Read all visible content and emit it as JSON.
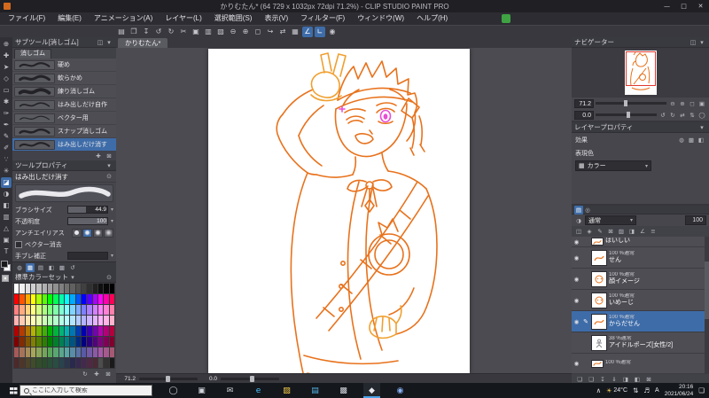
{
  "ui_colors": {
    "selection": "#3e6ca8",
    "line_orange": "#e8721c",
    "eye_pink": "#e84fd4",
    "active_app_underline": "#4aa3e8"
  },
  "titlebar": {
    "title": "かりむたん* (64 729 x 1032px 72dpi 71.2%) - CLIP STUDIO PAINT PRO",
    "minimize": "—",
    "maximize": "□",
    "close": "✕"
  },
  "menubar": {
    "items": [
      {
        "name": "menu-file",
        "label": "ファイル(F)"
      },
      {
        "name": "menu-edit",
        "label": "編集(E)"
      },
      {
        "name": "menu-animation",
        "label": "アニメーション(A)"
      },
      {
        "name": "menu-layer",
        "label": "レイヤー(L)"
      },
      {
        "name": "menu-selection",
        "label": "選択範囲(S)"
      },
      {
        "name": "menu-view",
        "label": "表示(V)"
      },
      {
        "name": "menu-filter",
        "label": "フィルター(F)"
      },
      {
        "name": "menu-window",
        "label": "ウィンドウ(W)"
      },
      {
        "name": "menu-help",
        "label": "ヘルプ(H)"
      }
    ]
  },
  "commandbar": {
    "icons": [
      {
        "name": "new-file-icon",
        "glyph": "▤"
      },
      {
        "name": "open-file-icon",
        "glyph": "❒"
      },
      {
        "name": "save-icon",
        "glyph": "↧"
      },
      {
        "name": "undo-icon",
        "glyph": "↺"
      },
      {
        "name": "redo-icon",
        "glyph": "↻"
      },
      {
        "name": "cut-icon",
        "glyph": "✂"
      },
      {
        "name": "copy-icon",
        "glyph": "▣"
      },
      {
        "name": "paste-icon",
        "glyph": "▥"
      },
      {
        "name": "erase-icon",
        "glyph": "▨"
      },
      {
        "name": "zoom-out-icon",
        "glyph": "⊖"
      },
      {
        "name": "zoom-in-icon",
        "glyph": "⊕"
      },
      {
        "name": "fit-screen-icon",
        "glyph": "◻"
      },
      {
        "name": "rotate-view-icon",
        "glyph": "↪"
      },
      {
        "name": "flip-view-icon",
        "glyph": "⇄"
      },
      {
        "name": "grid-icon",
        "glyph": "▦"
      },
      {
        "name": "snap-ruler-icon",
        "glyph": "∠",
        "active": true
      },
      {
        "name": "snap-special-ruler-icon",
        "glyph": "∟",
        "active": true
      },
      {
        "name": "workspace-settings-icon",
        "glyph": "◉"
      }
    ]
  },
  "toolstrip": {
    "tools": [
      {
        "name": "tool-zoom",
        "glyph": "⊕"
      },
      {
        "name": "tool-move",
        "glyph": "✚"
      },
      {
        "name": "tool-object",
        "glyph": "➤"
      },
      {
        "name": "tool-layer-move",
        "glyph": "◇"
      },
      {
        "name": "tool-selection",
        "glyph": "▭"
      },
      {
        "name": "tool-auto-select",
        "glyph": "✱"
      },
      {
        "name": "tool-eyedropper",
        "glyph": "✑"
      },
      {
        "name": "tool-pen",
        "glyph": "✒"
      },
      {
        "name": "tool-pencil",
        "glyph": "✎"
      },
      {
        "name": "tool-brush",
        "glyph": "✐"
      },
      {
        "name": "tool-airbrush",
        "glyph": "∵"
      },
      {
        "name": "tool-decoration",
        "glyph": "✳"
      },
      {
        "name": "tool-eraser",
        "glyph": "◪",
        "selected": true
      },
      {
        "name": "tool-blend",
        "glyph": "◑"
      },
      {
        "name": "tool-fill",
        "glyph": "◧"
      },
      {
        "name": "tool-gradient",
        "glyph": "▥"
      },
      {
        "name": "tool-figure",
        "glyph": "△"
      },
      {
        "name": "tool-frame",
        "glyph": "▣"
      },
      {
        "name": "tool-text",
        "glyph": "T"
      }
    ],
    "main_color": "#000000",
    "sub_color": "#ffffff"
  },
  "subtool": {
    "title": "サブツール[消しゴム]",
    "group_tab": "消しゴム",
    "items": [
      {
        "label": "硬め"
      },
      {
        "label": "軟らかめ"
      },
      {
        "label": "練り消しゴム"
      },
      {
        "label": "はみ出しだけ自作"
      },
      {
        "label": "ベクター用"
      },
      {
        "label": "スナップ消しゴム"
      },
      {
        "label": "はみ出しだけ消す",
        "selected": true
      }
    ],
    "footer_icons": [
      {
        "name": "add-subtool-icon",
        "glyph": "✚"
      },
      {
        "name": "delete-subtool-icon",
        "glyph": "⊠"
      }
    ]
  },
  "toolprop": {
    "title": "ツールプロパティ",
    "subtitle": "はみ出しだけ消す",
    "settings": [
      {
        "label": "ブラシサイズ",
        "value": "44.9"
      },
      {
        "label": "不透明度",
        "value": "100"
      },
      {
        "label": "アンチエイリアス",
        "value": ""
      },
      {
        "label": "ベクター消去",
        "value": ""
      },
      {
        "label": "手ブレ補正",
        "value": ""
      }
    ]
  },
  "colorset": {
    "title": "標準カラーセット",
    "tab_icons": [
      {
        "name": "color-wheel-icon",
        "glyph": "◍"
      },
      {
        "name": "color-set-icon",
        "glyph": "▦",
        "selected": true
      },
      {
        "name": "color-slider-icon",
        "glyph": "▤"
      },
      {
        "name": "color-mixer-icon",
        "glyph": "◧"
      },
      {
        "name": "approx-color-icon",
        "glyph": "▩"
      },
      {
        "name": "color-history-icon",
        "glyph": "↺"
      }
    ],
    "footer_icons": [
      {
        "name": "replace-color-icon",
        "glyph": "↻"
      },
      {
        "name": "add-color-icon",
        "glyph": "✚"
      },
      {
        "name": "delete-color-icon",
        "glyph": "⊠"
      }
    ],
    "rows": [
      [
        "#ffffff",
        "#f0f0f0",
        "#e0e0e0",
        "#d0d0d0",
        "#c0c0c0",
        "#b0b0b0",
        "#a0a0a0",
        "#909090",
        "#808080",
        "#707070",
        "#606060",
        "#505050",
        "#404040",
        "#303030",
        "#202020",
        "#101010",
        "#080808",
        "#000000"
      ],
      [
        "#ff0000",
        "#ff5500",
        "#ffaa00",
        "#ffff00",
        "#aaff00",
        "#55ff00",
        "#00ff00",
        "#00ff55",
        "#00ffaa",
        "#00ffff",
        "#00aaff",
        "#0055ff",
        "#0000ff",
        "#5500ff",
        "#aa00ff",
        "#ff00ff",
        "#ff00aa",
        "#ff0055"
      ],
      [
        "#ff8080",
        "#ffaa80",
        "#ffd480",
        "#ffff80",
        "#d4ff80",
        "#aaff80",
        "#80ff80",
        "#80ffaa",
        "#80ffd4",
        "#80ffff",
        "#80d4ff",
        "#80aaff",
        "#8080ff",
        "#aa80ff",
        "#d480ff",
        "#ff80ff",
        "#ff80d4",
        "#ff80aa"
      ],
      [
        "#ffb3b3",
        "#ffccb3",
        "#ffe6b3",
        "#ffffb3",
        "#e6ffb3",
        "#ccffb3",
        "#b3ffb3",
        "#b3ffcc",
        "#b3ffe6",
        "#b3ffff",
        "#b3e6ff",
        "#b3ccff",
        "#b3b3ff",
        "#ccb3ff",
        "#e6b3ff",
        "#ffb3ff",
        "#ffb3e6",
        "#ffb3cc"
      ],
      [
        "#b30000",
        "#b33c00",
        "#b37700",
        "#b3b300",
        "#77b300",
        "#3cb300",
        "#00b300",
        "#00b33c",
        "#00b377",
        "#00b3b3",
        "#0077b3",
        "#003cb3",
        "#0000b3",
        "#3c00b3",
        "#7700b3",
        "#b300b3",
        "#b30077",
        "#b3003c"
      ],
      [
        "#800000",
        "#802b00",
        "#805500",
        "#808000",
        "#558000",
        "#2b8000",
        "#008000",
        "#00802b",
        "#008055",
        "#008080",
        "#005580",
        "#002b80",
        "#000080",
        "#2b0080",
        "#550080",
        "#800080",
        "#800055",
        "#80002b"
      ],
      [
        "#a65959",
        "#a67359",
        "#a68c59",
        "#a6a659",
        "#8ca659",
        "#73a659",
        "#59a659",
        "#59a673",
        "#59a68c",
        "#59a6a6",
        "#598ca6",
        "#5973a6",
        "#5959a6",
        "#7359a6",
        "#8c59a6",
        "#a659a6",
        "#a6598c",
        "#a65973"
      ],
      [
        "#4d2929",
        "#4d3629",
        "#4d4329",
        "#3f4d29",
        "#324d29",
        "#294d29",
        "#294d36",
        "#294d43",
        "#29434d",
        "#29364d",
        "#29294d",
        "#36294d",
        "#43294d",
        "#4d2943",
        "#4d2936",
        "#4d4d4d",
        "#333333",
        "#1a1a1a"
      ]
    ]
  },
  "document": {
    "tab": "かりむたん*",
    "zoom": "71.2",
    "rotation": "0.0"
  },
  "navigator": {
    "title": "ナビゲーター",
    "zoom_value": "71.2",
    "rotation_value": "0.0",
    "zoom_icons": [
      {
        "name": "nav-zoom-out-icon",
        "glyph": "⊖"
      },
      {
        "name": "nav-zoom-in-icon",
        "glyph": "⊕"
      },
      {
        "name": "nav-fit-icon",
        "glyph": "◻"
      },
      {
        "name": "nav-actual-size-icon",
        "glyph": "▣"
      }
    ],
    "rotate_icons": [
      {
        "name": "nav-rotate-left-icon",
        "glyph": "↺"
      },
      {
        "name": "nav-rotate-right-icon",
        "glyph": "↻"
      },
      {
        "name": "nav-flip-horizontal-icon",
        "glyph": "⇄"
      },
      {
        "name": "nav-flip-vertical-icon",
        "glyph": "⇅"
      },
      {
        "name": "nav-reset-icon",
        "glyph": "◯"
      }
    ]
  },
  "layer_property": {
    "title": "レイヤープロパティ",
    "effect_label": "効果",
    "expression_label": "表現色",
    "expression_value": "カラー",
    "effect_icons": [
      {
        "name": "border-effect-icon",
        "glyph": "◍"
      },
      {
        "name": "tone-effect-icon",
        "glyph": "▩"
      },
      {
        "name": "layer-color-icon",
        "glyph": "◧"
      }
    ]
  },
  "layers": {
    "blend_mode": "通常",
    "opacity": "100",
    "tab_icons": [
      {
        "name": "layer-palette-tab-icon",
        "glyph": "▤",
        "selected": true
      },
      {
        "name": "layer-search-tab-icon",
        "glyph": "◎"
      }
    ],
    "lock_icons": [
      {
        "name": "clip-to-layer-icon",
        "glyph": "◫"
      },
      {
        "name": "reference-layer-icon",
        "glyph": "◈"
      },
      {
        "name": "draft-layer-icon",
        "glyph": "✎"
      },
      {
        "name": "lock-layer-icon",
        "glyph": "⊠"
      },
      {
        "name": "lock-transparent-icon",
        "glyph": "▨"
      },
      {
        "name": "enable-mask-icon",
        "glyph": "◨"
      },
      {
        "name": "ruler-range-icon",
        "glyph": "∠"
      },
      {
        "name": "set-as-ref-icon",
        "glyph": "≡"
      }
    ],
    "footer_icons": [
      {
        "name": "new-raster-layer-icon",
        "glyph": "❏"
      },
      {
        "name": "new-folder-icon",
        "glyph": "❑"
      },
      {
        "name": "transfer-down-icon",
        "glyph": "↧"
      },
      {
        "name": "merge-down-icon",
        "glyph": "⇓"
      },
      {
        "name": "create-mask-icon",
        "glyph": "◨"
      },
      {
        "name": "apply-mask-icon",
        "glyph": "◧"
      },
      {
        "name": "delete-layer-icon",
        "glyph": "⊠"
      }
    ],
    "rows": [
      {
        "meta": "",
        "name": "はいしい",
        "eye": true,
        "partial": true,
        "thumb": "sketch"
      },
      {
        "meta": "100 %通常",
        "name": "せん",
        "eye": true,
        "thumb": "sketch"
      },
      {
        "meta": "100 %通常",
        "name": "顔イメージ",
        "eye": true,
        "thumb": "face"
      },
      {
        "meta": "100 %通常",
        "name": "いめーじ",
        "eye": true,
        "thumb": "face"
      },
      {
        "meta": "100 %通常",
        "name": "からだせん",
        "eye": true,
        "selected": true,
        "thumb": "sketch"
      },
      {
        "meta": "38 %通常",
        "name": "アイドルポーズ[女性/2]",
        "eye": false,
        "thumb": "pose"
      },
      {
        "meta": "100 %通常",
        "name": "",
        "eye": true,
        "partial": true,
        "thumb": "sketch"
      }
    ]
  },
  "taskbar": {
    "search_placeholder": "ここに入力して検索",
    "apps": [
      {
        "name": "taskbar-cortana-icon",
        "glyph": "◯",
        "color": "#cfd3da"
      },
      {
        "name": "taskbar-task-view-icon",
        "glyph": "▣",
        "color": "#cfd3da"
      },
      {
        "name": "taskbar-mail-icon",
        "glyph": "✉",
        "color": "#cfd3da"
      },
      {
        "name": "taskbar-edge-icon",
        "glyph": "e",
        "color": "#4cc2ff"
      },
      {
        "name": "taskbar-explorer-icon",
        "glyph": "▨",
        "color": "#f3c94a"
      },
      {
        "name": "taskbar-store-icon",
        "glyph": "▤",
        "color": "#58b6e8"
      },
      {
        "name": "taskbar-photos-icon",
        "glyph": "▩",
        "color": "#cfd3da"
      },
      {
        "name": "taskbar-clip-studio-icon",
        "glyph": "◆",
        "color": "#e8e8ee",
        "active": true
      },
      {
        "name": "taskbar-browser-icon",
        "glyph": "◉",
        "color": "#8ab4f8"
      }
    ],
    "tray": {
      "chevron": "∧",
      "weather_icon": "☀",
      "temperature": "24°C",
      "network_icon": "⇅",
      "volume_icon": "♬",
      "ime": "A",
      "time": "20:16",
      "date": "2021/06/24",
      "notification_icon": "❏"
    }
  }
}
